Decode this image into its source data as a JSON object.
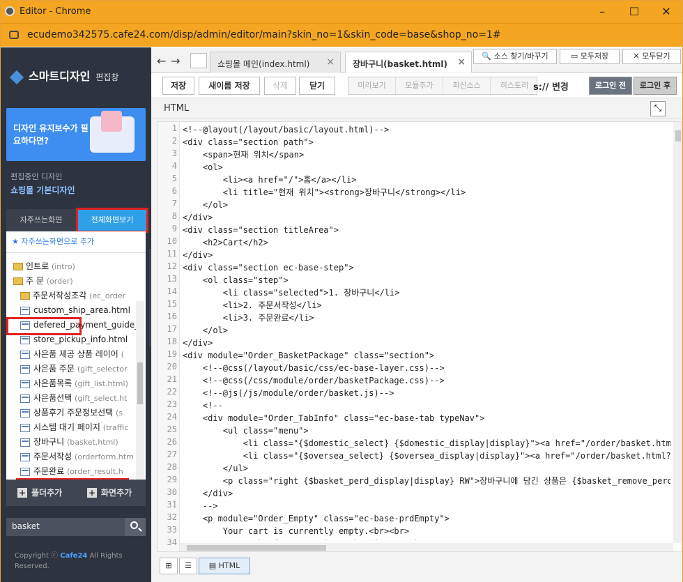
{
  "window": {
    "title": "Editor - Chrome",
    "controls": [
      "–",
      "☐",
      "✕"
    ]
  },
  "address": {
    "url": "ecudemo342575.cafe24.com/disp/admin/editor/main?skin_no=1&skin_code=base&shop_no=1#"
  },
  "sidebar": {
    "logo": "스마트디자인",
    "logo_sub": "편집창",
    "banner_text": "디자인 유지보수가 필요하다면?",
    "current_label": "편집중인 디자인",
    "current_value": "쇼핑몰 기본디자인",
    "tab_favorites": "자주쓰는화면",
    "tab_all": "전체화면보기",
    "add_favorite": "★ 자주쓰는화면으로 추가",
    "tree": [
      {
        "label": "인트로",
        "sub": "(intro)",
        "type": "folder"
      },
      {
        "label": "주 문",
        "sub": "(order)",
        "type": "folder-open"
      },
      {
        "label": "주문서작성조각",
        "sub": "(ec_order",
        "type": "folder"
      },
      {
        "label": "custom_ship_area.html",
        "sub": "",
        "type": "file"
      },
      {
        "label": "defered_payment_guide_",
        "sub": "",
        "type": "file"
      },
      {
        "label": "store_pickup_info.html",
        "sub": "",
        "type": "file"
      },
      {
        "label": "사은품 제공 상품 레이어",
        "sub": "(",
        "type": "file"
      },
      {
        "label": "사은품 주문",
        "sub": "(gift_selector",
        "type": "file"
      },
      {
        "label": "사은품목록",
        "sub": "(gift_list.html)",
        "type": "file"
      },
      {
        "label": "사은품선택",
        "sub": "(gift_select.ht",
        "type": "file"
      },
      {
        "label": "상품후기 주문정보선택",
        "sub": "(s",
        "type": "file"
      },
      {
        "label": "시스템 대기 페이지",
        "sub": "(traffic",
        "type": "file"
      },
      {
        "label": "장바구니",
        "sub": "(basket.html)",
        "type": "file"
      },
      {
        "label": "주문서작성",
        "sub": "(orderform.htm",
        "type": "file"
      },
      {
        "label": "주문완료",
        "sub": "(order_result.h",
        "type": "file"
      }
    ],
    "add_folder": "폴더추가",
    "add_screen": "화면추가",
    "search_value": "basket",
    "copyright_pre": "Copyright ⓒ",
    "copyright_brand": "Cafe24",
    "copyright_post": "All Rights Reserved."
  },
  "editor_tabs": [
    {
      "label": "쇼핑몰 메인(index.html)",
      "active": false
    },
    {
      "label": "장바구니(basket.html)",
      "active": true
    }
  ],
  "top_right": {
    "find": "소스 찾기/바꾸기",
    "save_all": "모두저장",
    "close_all": "모두닫기"
  },
  "toolbar": {
    "save": "저장",
    "save_as": "새이름 저장",
    "delete": "삭제",
    "close": "닫기",
    "seg": [
      "미리보기",
      "모듈추가",
      "최신소스",
      "히스토리"
    ],
    "change": "s:// 변경",
    "login_before": "로그인 전",
    "login_after": "로그인 후"
  },
  "mode_label": "HTML",
  "code_lines": [
    "<!--@layout(/layout/basic/layout.html)-->",
    "<div class=\"section path\">",
    "    <span>현재 위치</span>",
    "    <ol>",
    "        <li><a href=\"/\">홈</a></li>",
    "        <li title=\"현재 위치\"><strong>장바구니</strong></li>",
    "    </ol>",
    "</div>",
    "<div class=\"section titleArea\">",
    "    <h2>Cart</h2>",
    "</div>",
    "<div class=\"section ec-base-step\">",
    "    <ol class=\"step\">",
    "        <li class=\"selected\">1. 장바구니</li>",
    "        <li>2. 주문서작성</li>",
    "        <li>3. 주문완료</li>",
    "    </ol>",
    "</div>",
    "<div module=\"Order_BasketPackage\" class=\"section\">",
    "    <!--@css(/layout/basic/css/ec-base-layer.css)-->",
    "    <!--@css(/css/module/order/basketPackage.css)-->",
    "    <!--@js(/js/module/order/basket.js)-->",
    "    <!--",
    "    <div module=\"Order_TabInfo\" class=\"ec-base-tab typeNav\">",
    "        <ul class=\"menu\">",
    "            <li class=\"{$domestic_select} {$domestic_display|display}\"><a href=\"/order/basket.html\">국내배송상",
    "            <li class=\"{$oversea_select} {$oversea_display|display}\"><a href=\"/order/basket.html?delvtype=B\">해",
    "        </ul>",
    "        <p class=\"right {$basket_perd_display|display} RW\">장바구니에 담긴 상품은 {$basket_remove_perd}일 동안",
    "    </div>",
    "    -->",
    "    <p module=\"Order_Empty\" class=\"ec-base-prdEmpty\">",
    "        Your cart is currently empty.<br><br>",
    "            <a href=\"/\">Continue Shopping</a><br>"
  ],
  "bottom_mode": "HTML"
}
